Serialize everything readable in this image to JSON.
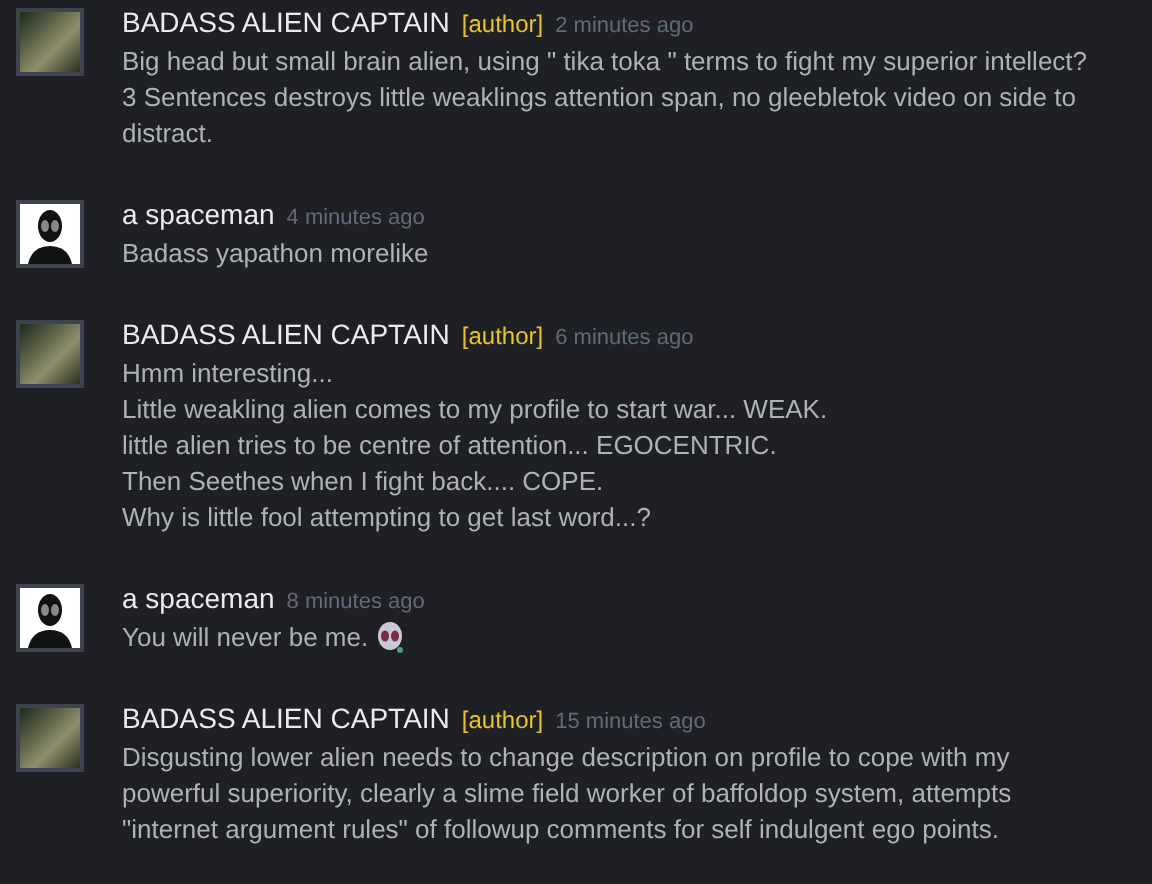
{
  "comments": [
    {
      "avatar": {
        "kind": "photo"
      },
      "name": "BADASS ALIEN CAPTAIN",
      "author_tag": "[author]",
      "time": "2 minutes ago",
      "lines": [
        "Big head but small brain alien, using \" tika toka \" terms to fight my superior intellect?",
        "3 Sentences destroys little weaklings attention span, no gleebletok video on side to distract."
      ],
      "emoticon": false
    },
    {
      "avatar": {
        "kind": "silhouette"
      },
      "name": "a spaceman",
      "time": "4 minutes ago",
      "lines": [
        "Badass yapathon morelike"
      ],
      "emoticon": false
    },
    {
      "avatar": {
        "kind": "photo"
      },
      "name": "BADASS ALIEN CAPTAIN",
      "author_tag": "[author]",
      "time": "6 minutes ago",
      "lines": [
        "Hmm interesting...",
        "Little weakling alien comes to my profile to start war... WEAK.",
        "little alien tries to be centre of attention... EGOCENTRIC.",
        "Then Seethes when I fight back.... COPE.",
        "Why is little fool attempting to get last word...?"
      ],
      "emoticon": false
    },
    {
      "avatar": {
        "kind": "silhouette"
      },
      "name": "a spaceman",
      "time": "8 minutes ago",
      "lines": [
        "You will never be me."
      ],
      "emoticon": true
    },
    {
      "avatar": {
        "kind": "photo"
      },
      "name": "BADASS ALIEN CAPTAIN",
      "author_tag": "[author]",
      "time": "15 minutes ago",
      "lines": [
        "Disgusting lower alien needs to change description on profile to cope with my powerful superiority, clearly a slime field worker of baffoldop system, attempts \"internet argument rules\" of followup comments for self indulgent ego points."
      ],
      "emoticon": false
    }
  ]
}
